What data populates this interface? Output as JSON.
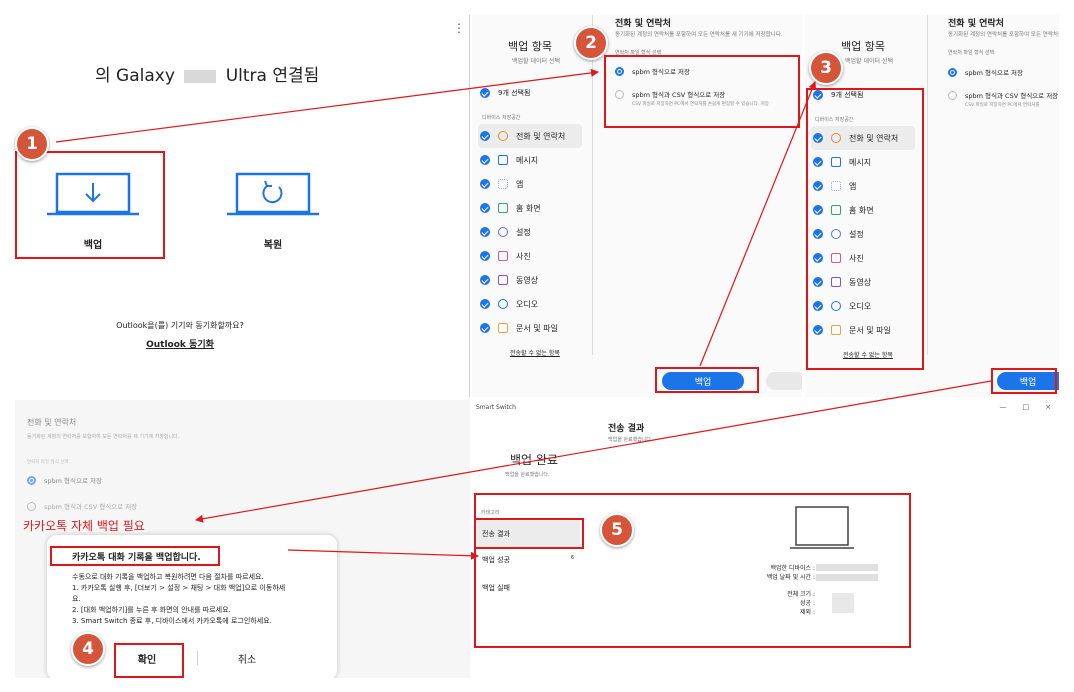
{
  "p1": {
    "title_prefix": "의 Galaxy",
    "title_suffix": "Ultra 연결됨",
    "backup_label": "백업",
    "restore_label": "복원",
    "outlook_question": "Outlook을(를) 기기와 동기화할까요?",
    "outlook_sync": "Outlook 동기화",
    "menu_icon": "⋮"
  },
  "p2": {
    "title": "백업 항목",
    "subtitle": "백업할 데이터 선택",
    "selected": "9개 선택됨",
    "device_storage": "디바이스 저장공간",
    "categories": [
      "전화 및 연락처",
      "메시지",
      "앱",
      "홈 화면",
      "설정",
      "사진",
      "동영상",
      "오디오",
      "문서 및 파일"
    ],
    "cannot_transfer": "전송할 수 없는 항목",
    "right_title": "전화 및 연락처",
    "right_desc": "동기화된 계정의 연락처를 포함하여 모든 연락처를 새 기기에 저장합니다.",
    "format_label": "연락처 파일 형식 선택",
    "option1": "spbm 형식으로 저장",
    "option2": "spbm 형식과 CSV 형식으로 저장",
    "option2_desc": "CSV 파일로 저장하면 PC에서 연락처를 손쉽게 편집할 수 있습니다. 저장",
    "backup_button": "백업"
  },
  "p3": {
    "title": "백업 항목",
    "subtitle": "백업할 데이터 선택",
    "selected": "9개 선택됨",
    "device_storage": "디바이스 저장공간",
    "categories": [
      "전화 및 연락처",
      "메시지",
      "앱",
      "홈 화면",
      "설정",
      "사진",
      "동영상",
      "오디오",
      "문서 및 파일"
    ],
    "cannot_transfer": "전송할 수 없는 항목",
    "right_title": "전화 및 연락처",
    "right_desc": "동기화된 계정의 연락처를 포함하여 모든 연락처를 새 기기에 저장합니다.",
    "format_label": "연락처 파일 형식 선택",
    "option1": "spbm 형식으로 저장",
    "option2": "spbm 형식과 CSV 형식으로 저장",
    "option2_desc": "CSV 파일로 저장하면 PC에서 연락처를",
    "backup_button": "백업"
  },
  "p4": {
    "title": "전화 및 연락처",
    "desc": "동기화된 계정의 연락처를 포함하여 모든 연락처를 새 기기에 저장합니다.",
    "format_label": "연락처 파일 형식 선택",
    "option1": "spbm 형식으로 저장",
    "option2": "spbm 형식과 CSV 형식으로 저장",
    "annotation": "카카오톡 자체 백업 필요",
    "dialog_title": "카카오톡 대화 기록을 백업합니다.",
    "dialog_lines": [
      "수동으로 대화 기록을 백업하고 복원하려면 다음 절차를 따르세요.",
      "1. 카카오톡 실행 후, [더보기 > 설정 > 채팅 > 대화 백업]으로 이동하세",
      "요.",
      "2. [대화 백업하기]를 누른 후 화면의 안내를 따르세요.",
      "3. Smart Switch 종료 후, 디바이스에서 카카오톡에 로그인하세요."
    ],
    "ok_button": "확인",
    "cancel_button": "취소"
  },
  "p5": {
    "app_title": "Smart Switch",
    "window_controls": [
      "—",
      "□",
      "×"
    ],
    "header": "전송 결과",
    "header_sub": "백업을 완료했습니다.",
    "done_title": "백업 완료",
    "done_sub": "백업을 완료했습니다.",
    "category_label": "카테고리",
    "menu": [
      "전송 결과",
      "백업 성공",
      "백업 실패"
    ],
    "success_count": "6",
    "info_labels": [
      "백업한 디바이스 :",
      "백업 날짜 및 시간 :",
      "전체 크기 :",
      "성공 :",
      "제외 :"
    ]
  },
  "badges": [
    "1",
    "2",
    "3",
    "4",
    "5"
  ],
  "colors": {
    "accent_blue": "#1b74e8",
    "highlight_red": "#e0161b",
    "badge_orange": "#d4553a"
  }
}
